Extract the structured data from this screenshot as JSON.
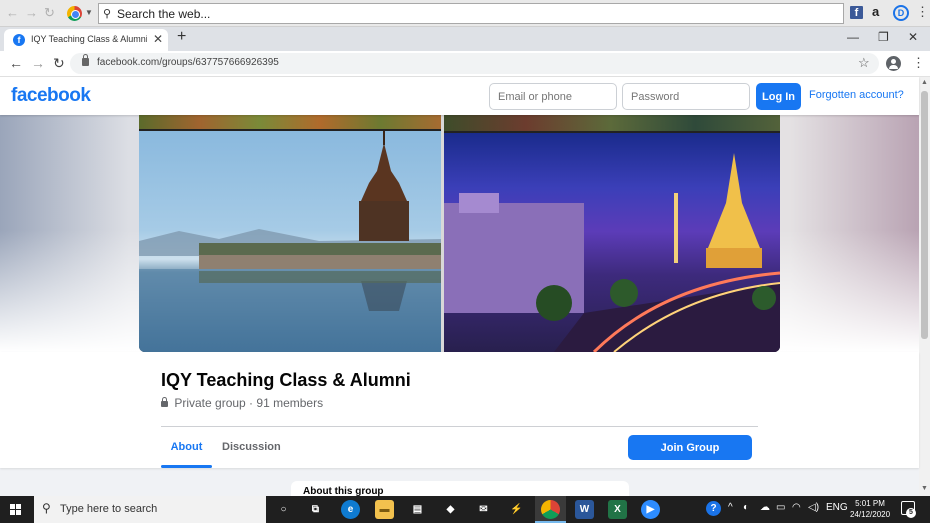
{
  "browser": {
    "web_search_placeholder": "Search the web...",
    "tab_title": "IQY Teaching Class & Alumni | Fa",
    "tab_favicon": "f",
    "url": "facebook.com/groups/637757666926395"
  },
  "facebook": {
    "logo": "facebook",
    "email_placeholder": "Email or phone",
    "password_placeholder": "Password",
    "login_label": "Log In",
    "forgot_label": "Forgotten account?"
  },
  "group": {
    "name": "IQY Teaching Class & Alumni",
    "privacy": "Private group",
    "members": "91 members",
    "tabs": [
      {
        "label": "About"
      },
      {
        "label": "Discussion"
      }
    ],
    "join_label": "Join Group",
    "section_peek": "About this group"
  },
  "taskbar": {
    "search_placeholder": "Type here to search",
    "language": "ENG",
    "time": "5:01 PM",
    "date": "24/12/2020",
    "notifications": "5"
  },
  "colors": {
    "fb_blue": "#1877f2",
    "taskbar": "#1f1f1f",
    "page_bg": "#f0f2f5"
  }
}
